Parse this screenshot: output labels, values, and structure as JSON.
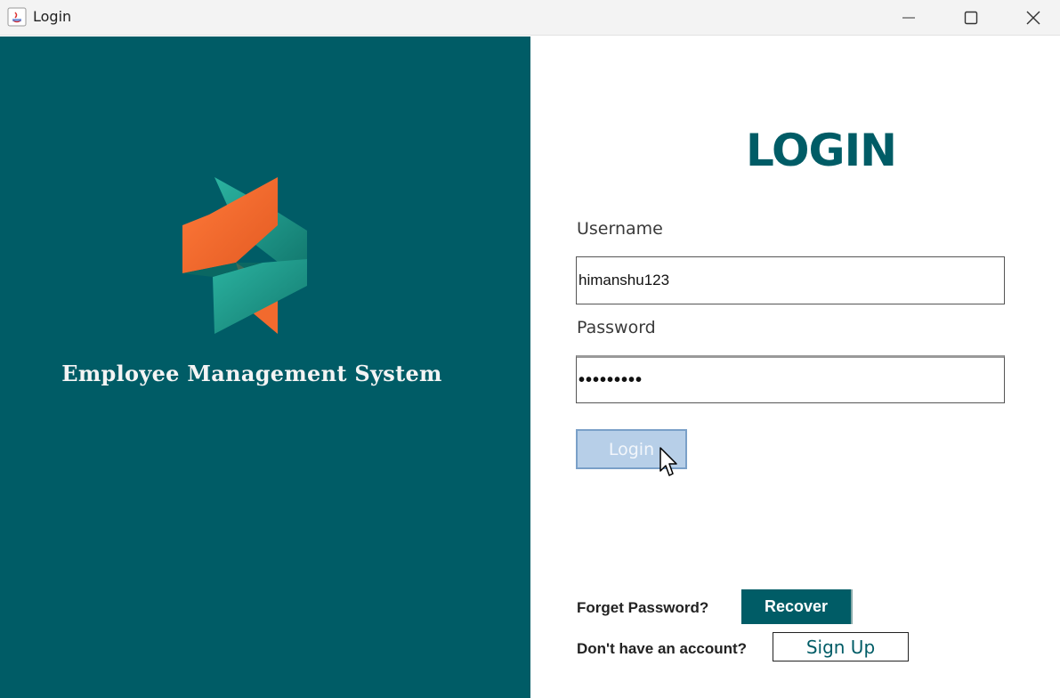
{
  "window": {
    "title": "Login",
    "controls": [
      "minimize-icon",
      "maximize-icon",
      "close-icon"
    ]
  },
  "left_panel": {
    "app_name": "Employee Management System",
    "logo_icon": "interlocking-ribbon-logo",
    "background_color": "#005c66"
  },
  "form": {
    "heading": "LOGIN",
    "username_label": "Username",
    "username_value": "himanshu123",
    "password_label": "Password",
    "password_value": "•••••••••",
    "login_button": "Login"
  },
  "footer": {
    "forget_text": "Forget Password?",
    "recover_button": "Recover",
    "no_account_text": "Don't have an account?",
    "signup_button": "Sign Up"
  },
  "colors": {
    "accent": "#005c66",
    "logo_orange": "#f26a2e",
    "logo_teal": "#1e9c8d",
    "login_button_bg": "#b7cfe8"
  }
}
